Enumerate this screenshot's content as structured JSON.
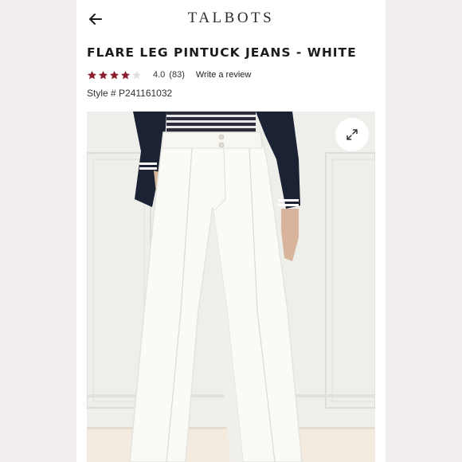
{
  "header": {
    "back_icon": "arrow-left-icon",
    "brand": "TALBOTS"
  },
  "product": {
    "title": "FLARE LEG PINTUCK JEANS - WHITE",
    "rating": 4.0,
    "rating_text": "4.0",
    "review_count": "(83)",
    "write_review": "Write a review",
    "style": "Style # P241161032",
    "star_color": "#8b1d2c"
  },
  "image": {
    "expand_icon": "expand-icon",
    "alt": "White flare leg pintuck jeans"
  }
}
